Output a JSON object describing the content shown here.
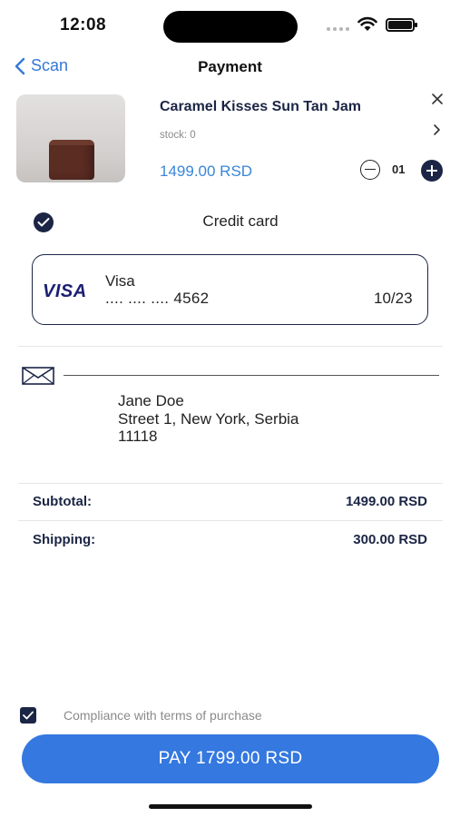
{
  "status_bar": {
    "time": "12:08"
  },
  "nav": {
    "back_label": "Scan",
    "title": "Payment"
  },
  "product": {
    "name": "Caramel Kisses Sun Tan Jam",
    "stock": "stock: 0",
    "price": "1499.00 RSD",
    "quantity": "01"
  },
  "payment": {
    "method": "Credit card",
    "card_brand": "VISA",
    "card_name": "Visa",
    "card_number": ".... .... .... 4562",
    "card_expiry": "10/23"
  },
  "address": {
    "name": "Jane Doe",
    "street": "Street 1, New York, Serbia",
    "zip": "11118"
  },
  "summary": {
    "subtotal_label": "Subtotal:",
    "subtotal_value": "1499.00 RSD",
    "shipping_label": "Shipping:",
    "shipping_value": "300.00 RSD"
  },
  "footer": {
    "terms_label": "Compliance with terms of purchase",
    "pay_label": "PAY 1799.00 RSD"
  },
  "colors": {
    "accent": "#3478e0",
    "navy": "#1b2545",
    "price_blue": "#3a86d9"
  }
}
